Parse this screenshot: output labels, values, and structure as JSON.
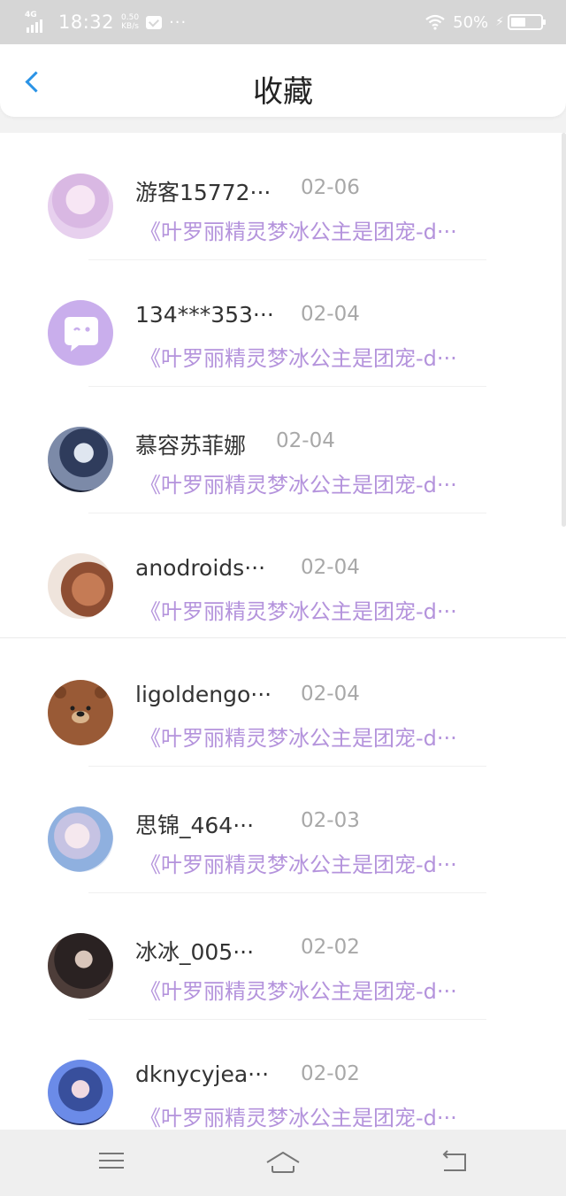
{
  "status_bar": {
    "network": "4G",
    "time": "18:32",
    "speed_value": "0.50",
    "speed_unit": "KB/s",
    "more": "···",
    "battery_pct": "50%",
    "battery_level": 0.5
  },
  "header": {
    "title": "收藏",
    "back_icon": "chevron-left-icon"
  },
  "favorites": [
    {
      "name": "游客15772···",
      "date": "02-06",
      "link": "《叶罗丽精灵梦冰公主是团宠-d···"
    },
    {
      "name": "134***353···",
      "date": "02-04",
      "link": "《叶罗丽精灵梦冰公主是团宠-d···"
    },
    {
      "name": "慕容苏菲娜",
      "date": "02-04",
      "link": "《叶罗丽精灵梦冰公主是团宠-d···"
    },
    {
      "name": "anodroids···",
      "date": "02-04",
      "link": "《叶罗丽精灵梦冰公主是团宠-d···"
    },
    {
      "name": "ligoldengo···",
      "date": "02-04",
      "link": "《叶罗丽精灵梦冰公主是团宠-d···"
    },
    {
      "name": "思锦_464···",
      "date": "02-03",
      "link": "《叶罗丽精灵梦冰公主是团宠-d···"
    },
    {
      "name": "冰冰_005···",
      "date": "02-02",
      "link": "《叶罗丽精灵梦冰公主是团宠-d···"
    },
    {
      "name": "dknycyjea···",
      "date": "02-02",
      "link": "《叶罗丽精灵梦冰公主是团宠-d···"
    }
  ],
  "nav_bar": {
    "menu_icon": "menu-icon",
    "home_icon": "home-icon",
    "back_icon": "return-icon"
  }
}
